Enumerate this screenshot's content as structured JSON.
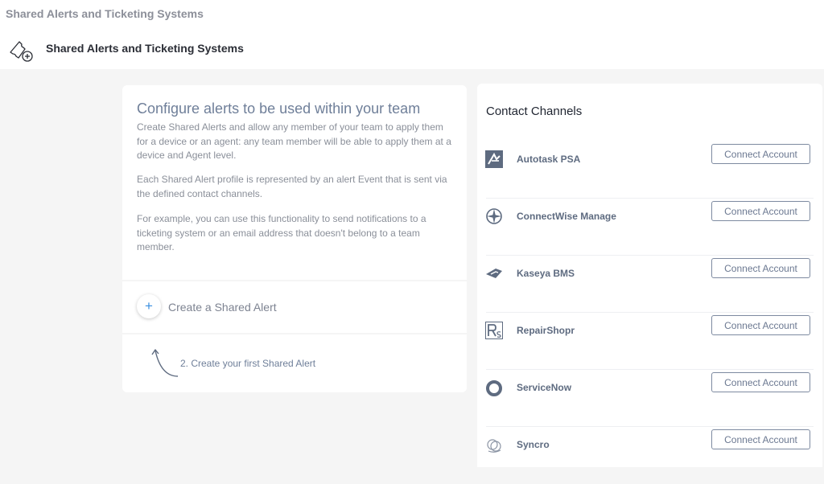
{
  "window": {
    "title": "Shared Alerts and Ticketing Systems"
  },
  "header": {
    "title": "Shared Alerts and Ticketing Systems",
    "icon": "ticket-plus-icon"
  },
  "info": {
    "heading": "Configure alerts to be used within your team",
    "paragraphs": [
      "Create Shared Alerts and allow any member of your team to apply them for a device or an agent: any team member will be able to apply them at a device and Agent level.",
      "Each Shared Alert profile is represented by an alert Event that is sent via the defined contact channels.",
      "For example, you can use this functionality to send notifications to a ticketing system or an email address that doesn't belong to a team member."
    ]
  },
  "create": {
    "plus": "+",
    "label": "Create a Shared Alert"
  },
  "hint": {
    "text": "2. Create your first Shared Alert"
  },
  "channels": {
    "title": "Contact Channels",
    "items": [
      {
        "name": "Autotask PSA",
        "button": "Connect Account",
        "icon": "autotask-logo-icon"
      },
      {
        "name": "ConnectWise Manage",
        "button": "Connect Account",
        "icon": "connectwise-logo-icon"
      },
      {
        "name": "Kaseya BMS",
        "button": "Connect Account",
        "icon": "kaseya-logo-icon"
      },
      {
        "name": "RepairShopr",
        "button": "Connect Account",
        "icon": "repairshopr-logo-icon"
      },
      {
        "name": "ServiceNow",
        "button": "Connect Account",
        "icon": "servicenow-logo-icon"
      },
      {
        "name": "Syncro",
        "button": "Connect Account",
        "icon": "syncro-logo-icon"
      }
    ]
  },
  "colors": {
    "accent": "#3a8fe0",
    "heading": "#6f7f99",
    "button_border": "#7d8aa0"
  }
}
